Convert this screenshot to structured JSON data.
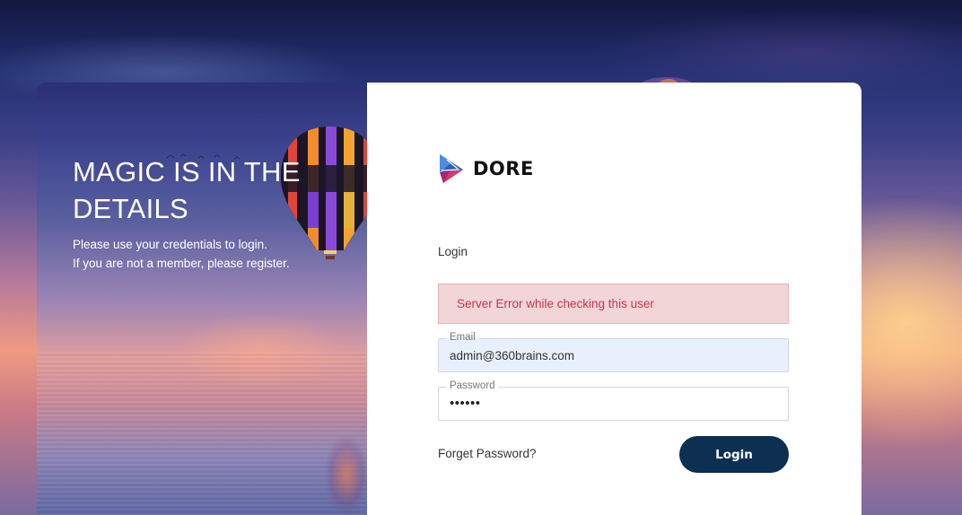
{
  "hero": {
    "title": "MAGIC IS IN THE DETAILS",
    "subtitle_line1": "Please use your credentials to login.",
    "subtitle_line2": "If you are not a member, please register."
  },
  "brand": {
    "name": "DORE"
  },
  "form": {
    "heading": "Login",
    "error_message": "Server Error while checking this user",
    "email_label": "Email",
    "email_value": "admin@360brains.com",
    "password_label": "Password",
    "password_value": "••••••",
    "forget_password_label": "Forget Password?",
    "login_button_label": "Login"
  },
  "colors": {
    "button": "#0c2f52",
    "error_background": "#f1d5d7",
    "error_text": "#c0394f",
    "autofill_background": "#e8f0fe"
  },
  "icons": {
    "brand_logo": "dore-logo-icon"
  }
}
